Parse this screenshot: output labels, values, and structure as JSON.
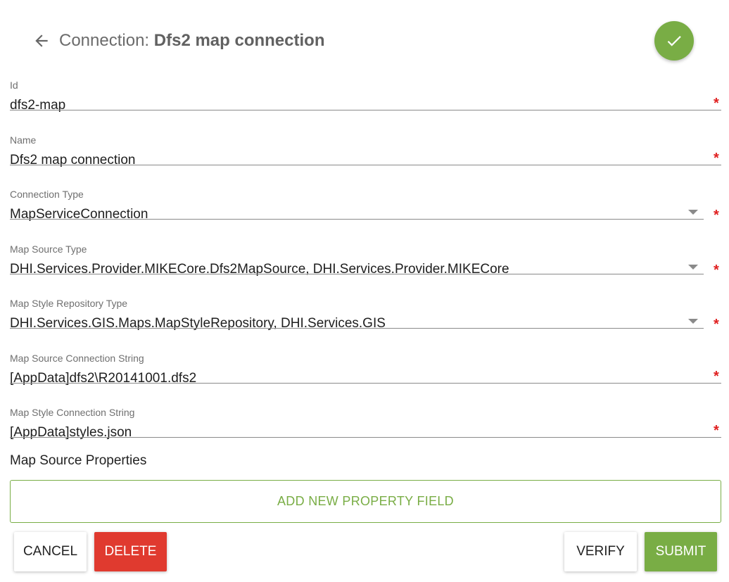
{
  "header": {
    "title_prefix": "Connection: ",
    "title_name": "Dfs2 map connection",
    "back_icon": "arrow-left-icon",
    "confirm_icon": "check-icon"
  },
  "fields": {
    "id": {
      "label": "Id",
      "value": "dfs2-map",
      "required_mark": "*"
    },
    "name": {
      "label": "Name",
      "value": "Dfs2 map connection",
      "required_mark": "*"
    },
    "connection_type": {
      "label": "Connection Type",
      "value": "MapServiceConnection",
      "required_mark": "*"
    },
    "map_source_type": {
      "label": "Map Source Type",
      "value": "DHI.Services.Provider.MIKECore.Dfs2MapSource, DHI.Services.Provider.MIKECore",
      "required_mark": "*"
    },
    "map_style_repository_type": {
      "label": "Map Style Repository Type",
      "value": "DHI.Services.GIS.Maps.MapStyleRepository, DHI.Services.GIS",
      "required_mark": "*"
    },
    "map_source_connection_string": {
      "label": "Map Source Connection String",
      "value": "[AppData]dfs2\\R20141001.dfs2",
      "required_mark": "*"
    },
    "map_style_connection_string": {
      "label": "Map Style Connection String",
      "value": "[AppData]styles.json",
      "required_mark": "*"
    }
  },
  "properties": {
    "title": "Map Source Properties",
    "add_label": "ADD NEW PROPERTY FIELD"
  },
  "actions": {
    "cancel": "CANCEL",
    "delete": "DELETE",
    "verify": "VERIFY",
    "submit": "SUBMIT"
  },
  "colors": {
    "accent": "#79ad45",
    "danger": "#e03a2f",
    "required": "#e02020"
  }
}
